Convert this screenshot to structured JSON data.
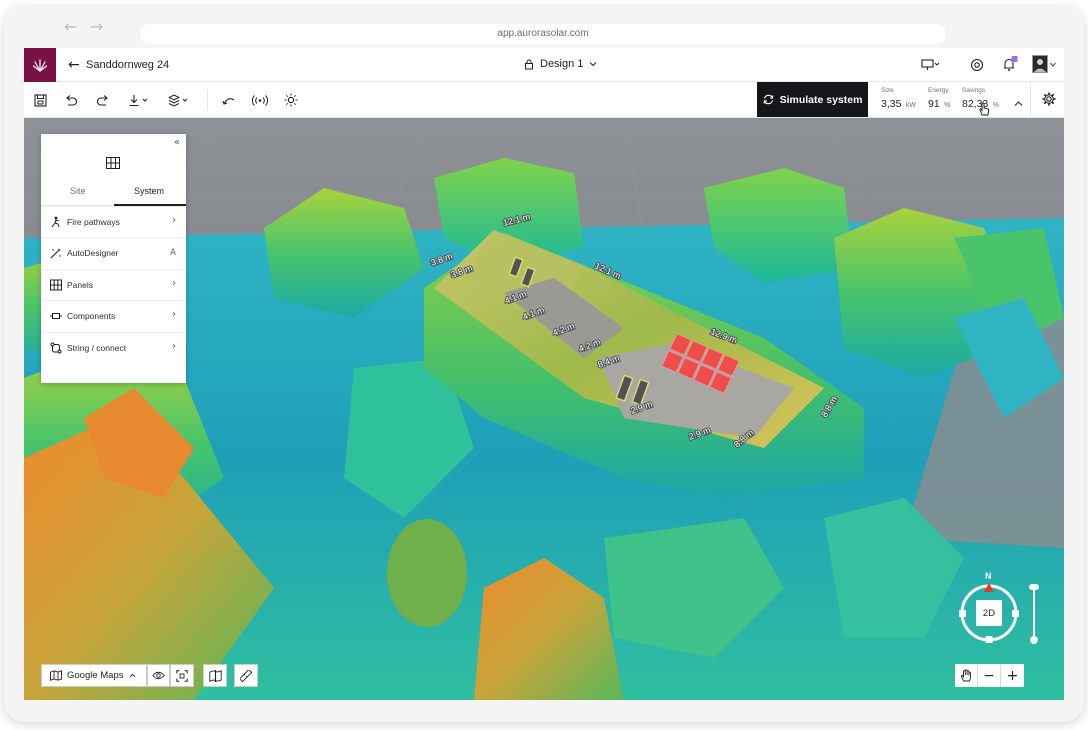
{
  "browser": {
    "url": "app.aurorasolar.com",
    "back_icon": "arrow-left-icon",
    "forward_icon": "arrow-right-icon"
  },
  "header": {
    "project_name": "Sanddornweg 24",
    "design_name": "Design 1",
    "notification_badge_color": "#9b6cf2"
  },
  "toolbar": {
    "simulate_label": "Simulate system",
    "metrics": [
      {
        "label": "Size",
        "value": "3,35",
        "unit": "kW"
      },
      {
        "label": "Energy",
        "value": "91",
        "unit": "%"
      },
      {
        "label": "Savings",
        "value": "82,33",
        "unit": "%"
      }
    ]
  },
  "panel": {
    "tabs": [
      {
        "label": "Site"
      },
      {
        "label": "System"
      }
    ],
    "active_tab": "System",
    "items": [
      {
        "label": "Fire pathways",
        "icon": "fire-pathway-icon",
        "right": "›"
      },
      {
        "label": "AutoDesigner",
        "icon": "magic-wand-icon",
        "right": "A"
      },
      {
        "label": "Panels",
        "icon": "grid-icon",
        "right": "›"
      },
      {
        "label": "Components",
        "icon": "component-icon",
        "right": "›"
      },
      {
        "label": "String / connect",
        "icon": "string-connect-icon",
        "right": "›"
      }
    ]
  },
  "map": {
    "imagery_source": "Google Maps",
    "view_mode": "2D",
    "north_label": "N",
    "measurements": [
      "12.1 m",
      "12.1 m",
      "3.8 m",
      "3.8 m",
      "4.1 m",
      "4.1 m",
      "4.2 m",
      "4.2 m",
      "8.4 m",
      "12.9 m",
      "2.9 m",
      "8.8 m",
      "8.8 m",
      "2.9 m"
    ]
  },
  "colors": {
    "brand": "#7a1045",
    "simulate_bg": "#14161a",
    "panel_array": "#ef4c4c"
  }
}
